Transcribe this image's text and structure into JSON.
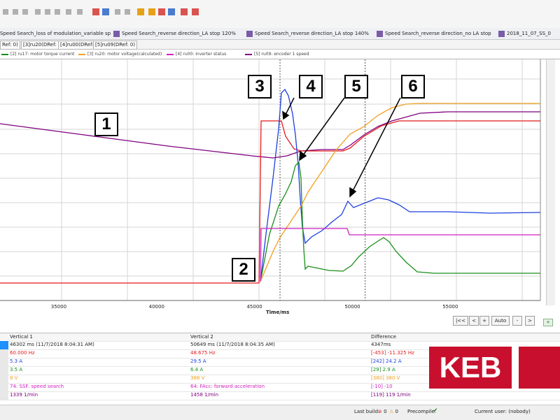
{
  "tabs": [
    {
      "label": "Speed Search_loss of modulation_variable speed"
    },
    {
      "label": "Speed Search_reverse direction_LA stop 120%"
    },
    {
      "label": "Speed Search_reverse direction_LA stop 140%"
    },
    {
      "label": "Speed Search_reverse direction_no LA stop"
    },
    {
      "label": "2018_11_07_SS_0"
    }
  ],
  "subtabs": [
    {
      "label": "Ref: 0)"
    },
    {
      "label": "[3]ru20(DRef: 0)"
    },
    {
      "label": "[4]ru00(DRef: 0)"
    },
    {
      "label": "[5]ru09(DRef: 0)"
    }
  ],
  "legend": [
    {
      "label": "[2] ru17: motor torque current",
      "color": "#1a8f1a"
    },
    {
      "label": "[3] ru20: motor voltage(calculated)",
      "color": "#f0a020"
    },
    {
      "label": "[4] ru00: inverter status",
      "color": "#d020c0"
    },
    {
      "label": "[5] ru09: encoder 1 speed",
      "color": "#800080"
    }
  ],
  "chart_data": {
    "type": "line",
    "xlabel": "Time/ms",
    "x_ticks": [
      35000,
      40000,
      45000,
      50000,
      55000
    ],
    "xlim": [
      32000,
      59600
    ],
    "cursors": [
      46302,
      50649
    ],
    "annotations": [
      "1",
      "2",
      "3",
      "4",
      "5",
      "6"
    ],
    "colors": {
      "red": "#e41a1c",
      "blue": "#1f3fe0",
      "green": "#1a8f1a",
      "orange": "#f0a020",
      "magenta": "#d020c0",
      "purple": "#800080"
    }
  },
  "nav": {
    "first": "|<<",
    "prev": "<",
    "plus": "+",
    "auto": "Auto",
    "minus": "-",
    "next": ">",
    "extra": "+"
  },
  "table": {
    "headers": [
      "Vertical 1",
      "Vertical 2",
      "Difference"
    ],
    "rows": [
      {
        "v1": "46302 ms (11/7/2018 8:04:31 AM)",
        "v2": "50649 ms (11/7/2018 8:04:35 AM)",
        "diff": "4347ms",
        "color": "#222222"
      },
      {
        "v1": "60.000 Hz",
        "v2": "48.675 Hz",
        "diff": "[-453] -11.325 Hz",
        "color": "#e41a1c"
      },
      {
        "v1": "5.3 A",
        "v2": "29.5 A",
        "diff": "[242] 24.2 A",
        "color": "#1f3fe0"
      },
      {
        "v1": "3.5 A",
        "v2": "6.4 A",
        "diff": "[29] 2.9 A",
        "color": "#1a8f1a"
      },
      {
        "v1": "8 V",
        "v2": "388 V",
        "diff": "[380] 380 V",
        "color": "#f0a020"
      },
      {
        "v1": "74: SSF: speed search",
        "v2": "64: FAcc: forward acceleration",
        "diff": "[-10] -10",
        "color": "#d020c0"
      },
      {
        "v1": "1339 1/min",
        "v2": "1458 1/min",
        "diff": "[119] 119 1/min",
        "color": "#800080"
      }
    ]
  },
  "status": {
    "last_build": "Last build:",
    "errors": "0",
    "warnings": "0",
    "precompile": "Precompile:",
    "current_user": "Current user: (nobody)"
  },
  "logo": {
    "text": "KEB"
  }
}
